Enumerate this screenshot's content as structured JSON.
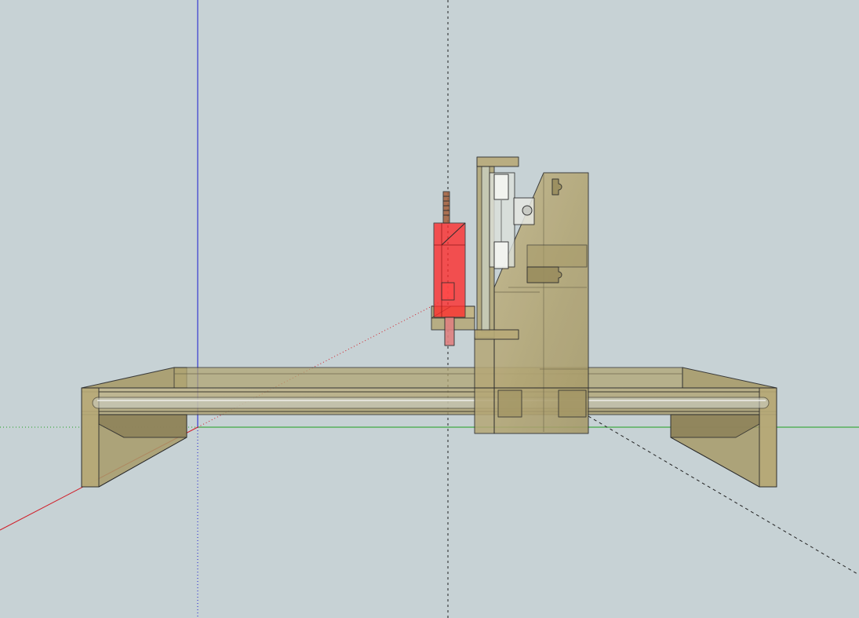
{
  "viewport": {
    "background": "#c7d2d5",
    "axis_colors": {
      "x": "#d0202a",
      "y": "#1fa01f",
      "z": "#1a1ad0"
    }
  },
  "model": {
    "components": [
      "base-frame",
      "x-rail",
      "gantry-side-plate",
      "z-axis-carriage",
      "spindle"
    ],
    "colors": {
      "wood": "#b4a676",
      "wood_dark": "#8f835a",
      "spindle": "#ff2a2a",
      "rail": "#ccd0c8",
      "edge": "#2b2b2b"
    }
  }
}
